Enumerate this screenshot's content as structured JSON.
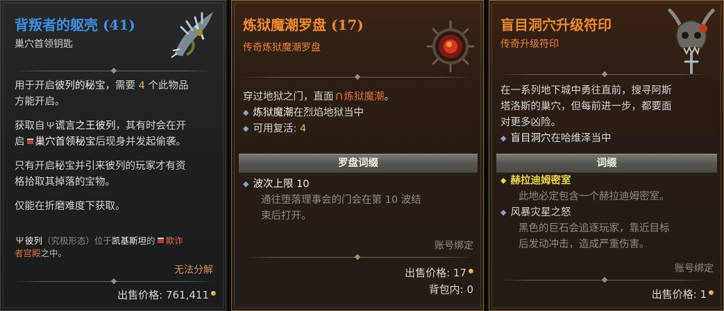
{
  "card1": {
    "title": "背叛者的躯壳 (41)",
    "subtitle": "巢穴首领钥匙",
    "p1_l1_a": "用于开启",
    "p1_l1_b": "彼列的秘宝",
    "p1_l1_c": "，需要",
    "p1_l1_num": "4",
    "p1_l1_d": "个此物品",
    "p1_l2": "方能开启。",
    "p2_l1_a": "获取自",
    "p2_l1_b": "谎言之王彼列",
    "p2_l1_c": "，其有时会在开",
    "p2_l2_a": "启",
    "p2_l2_b": "巢穴首领秘宝",
    "p2_l2_c": "后现身并发起偷袭。",
    "p3_l1": "只有开启秘宝并引来彼列的玩家才有资",
    "p3_l2": "格拾取其掉落的宝物。",
    "p4_l1": "仅能在折磨难度下获取。",
    "loc_l1_a": "彼列",
    "loc_l1_b": "（究极形态）位于",
    "loc_l1_c": "凯基斯坦",
    "loc_l1_d": "的",
    "loc_l1_e": "欺诈",
    "loc_l2_a": "者宫殿",
    "loc_l2_b": "之中。",
    "no_salvage": "无法分解",
    "price_label": "出售价格:",
    "price_value": "761,411"
  },
  "card2": {
    "title": "炼狱魔潮罗盘 (17)",
    "subtitle": "传奇炼狱魔潮罗盘",
    "l1_a": "穿过地狱之门，直面",
    "l1_b": "炼狱魔潮",
    "l1_c": "。",
    "b1_a": "炼狱魔潮",
    "b1_b": "在烈焰地狱当中",
    "b2_a": "可用复活: ",
    "b2_num": "4",
    "section": "罗盘词缀",
    "affix1_a": "波次上限 ",
    "affix1_b": "10",
    "affix1_desc_l1": "通往堕落理事会的门会在第 10 波结",
    "affix1_desc_l2": "束后打开。",
    "bound": "账号绑定",
    "price_label": "出售价格:",
    "price_value": "17",
    "bag_label": "背包内:",
    "bag_value": "0"
  },
  "card3": {
    "title": "盲目洞穴升级符印",
    "subtitle": "传奇升级符印",
    "l1": "在一系列地下城中勇往直前，搜寻阿斯",
    "l2": "塔洛斯的巢穴，但每前进一步，都要面",
    "l3": "对更多凶险。",
    "b1_a": "盲目洞穴",
    "b1_b": "在哈维泽当中",
    "section": "词缀",
    "affix1": "赫拉迪姆密室",
    "affix1_desc": "此地必定包含一个赫拉迪姆密室。",
    "affix2": "风暴灾星之怒",
    "affix2_desc_l1": "黑色的巨石会追逐玩家，靠近目标",
    "affix2_desc_l2": "后发动冲击，造成严重伤害。",
    "bound": "账号绑定",
    "price_label": "出售价格:",
    "price_value": "1"
  },
  "colors": {
    "title_blue": "#3f8fe0",
    "title_orange": "#ee8a2e",
    "subtitle_orange": "#e8823a",
    "highlight_orange": "#e06c3c",
    "number_gold": "#e4b85a",
    "affix_yellow": "#e8d84a",
    "no_salvage_red": "#d28a5e"
  },
  "icons": [
    "spine-claw-icon",
    "infernal-compass-icon",
    "horned-skull-sigil-icon",
    "trident-icon",
    "gold-coin-icon"
  ]
}
